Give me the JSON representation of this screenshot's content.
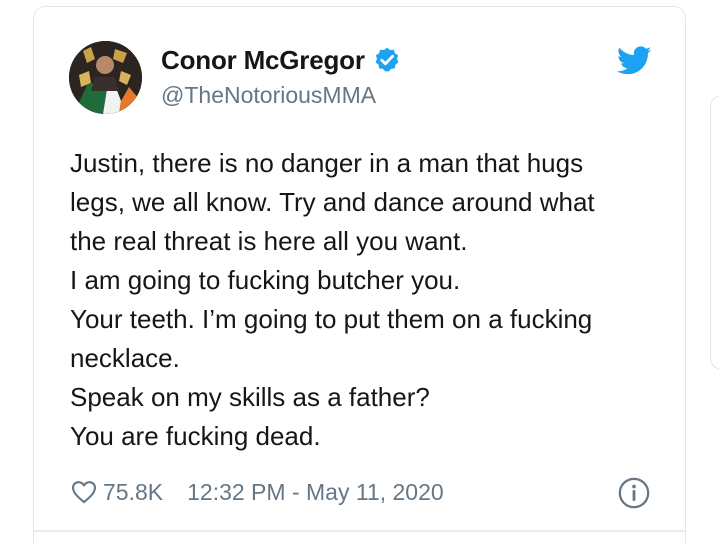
{
  "tweet": {
    "author_name": "Conor McGregor",
    "author_handle": "@TheNotoriousMMA",
    "lines": [
      "Justin, there is no danger in a man that hugs",
      "legs, we all know. Try and dance around what",
      "the real threat is here all you want.",
      "I am going to fucking butcher you.",
      "Your teeth. I’m going to put them on a fucking",
      "necklace.",
      "Speak on my skills as a father?",
      "You are fucking dead."
    ],
    "like_count": "75.8K",
    "timestamp": "12:32 PM - May 11, 2020"
  },
  "icons": {
    "verified": "verified-badge-icon",
    "twitter": "twitter-bird-icon",
    "like": "heart-icon",
    "info": "info-icon"
  },
  "colors": {
    "twitter_blue": "#1da1f2",
    "text_primary": "#14171a",
    "text_secondary": "#657786",
    "border": "#e1e8ed"
  }
}
